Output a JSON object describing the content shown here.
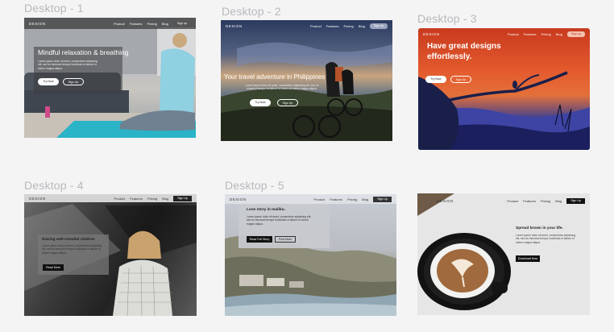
{
  "frames": [
    {
      "label": "Desktop - 1",
      "nav": {
        "logo": "DESIGN",
        "links": [
          "Product",
          "Features",
          "Pricing",
          "Blog"
        ],
        "signup": "Sign up"
      },
      "title": "Mindful relaxation & breathing",
      "subtitle": "Lorem ipsum dolor sit amet, consectetur adipiscing elit, sed do eiusmod tempor incididunt ut labore et dolore magna aliqua.",
      "primary_button": "Try Now",
      "secondary_button": "Sign Up"
    },
    {
      "label": "Desktop - 2",
      "nav": {
        "logo": "DESIGN",
        "links": [
          "Product",
          "Features",
          "Pricing",
          "Blog"
        ],
        "signup": "Sign up"
      },
      "title": "Your travel adventure in Philippines",
      "subtitle": "Lorem ipsum dolor sit amet, consectetur adipiscing elit, sed do eiusmod tempor incididunt ut labore et dolore magna aliqua.",
      "primary_button": "Try Now",
      "secondary_button": "Sign Up"
    },
    {
      "label": "Desktop - 3",
      "nav": {
        "logo": "DESIGN",
        "links": [
          "Product",
          "Features",
          "Pricing",
          "Blog"
        ],
        "signup": "Sign up"
      },
      "title_line1": "Have great designs",
      "title_line2": "effortlessly.",
      "primary_button": "Try Now",
      "secondary_button": "Sign Up"
    },
    {
      "label": "Desktop - 4",
      "nav": {
        "logo": "DESIGN",
        "links": [
          "Product",
          "Features",
          "Pricing",
          "Blog"
        ],
        "signup": "Sign Up"
      },
      "title": "Raising well-rounded children",
      "subtitle": "Lorem ipsum dolor sit amet, consectetur adipiscing elit, sed do eiusmod tempor incididunt ut labore et dolore magna aliqua.",
      "primary_button": "Read More"
    },
    {
      "label": "Desktop - 5",
      "nav": {
        "logo": "DESIGN",
        "links": [
          "Product",
          "Features",
          "Pricing",
          "Blog"
        ],
        "signup": "Sign Up"
      },
      "title": "Love story in malibu.",
      "subtitle": "Lorem ipsum dolor sit amet, consectetur adipiscing elit, sed do eiusmod tempor incididunt ut labore et dolore magna aliqua.",
      "primary_button": "Read Full Story",
      "secondary_button": "Find More"
    },
    {
      "label": "",
      "nav": {
        "logo": "DESIGN",
        "links": [
          "Product",
          "Features",
          "Pricing",
          "Blog"
        ],
        "signup": "Sign Up"
      },
      "title": "Spread brown in your life.",
      "subtitle": "Lorem ipsum dolor sit amet, consectetur adipiscing elit, sed do eiusmod tempor incididunt ut labore et dolore magna aliqua.",
      "primary_button": "Download Now"
    }
  ]
}
